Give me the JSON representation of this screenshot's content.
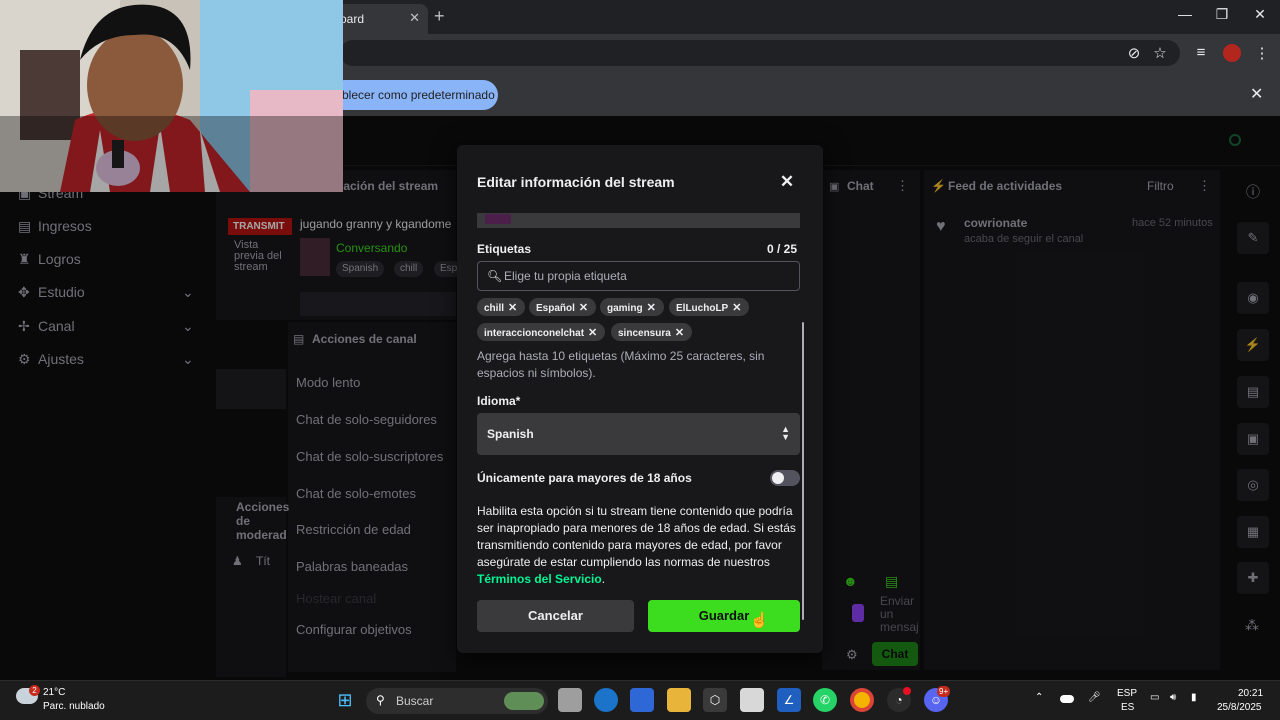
{
  "browser": {
    "tab_title": "oard",
    "infobar_button": "blecer como predeterminado"
  },
  "sidebar": {
    "items": [
      {
        "label": "Stream"
      },
      {
        "label": "Ingresos"
      },
      {
        "label": "Logros"
      },
      {
        "label": "Estudio"
      },
      {
        "label": "Canal"
      },
      {
        "label": "Ajustes"
      }
    ]
  },
  "stream_panel": {
    "header": "nación del stream",
    "live_badge": "TRANSMIT",
    "preview_label": "Vista previa del stream",
    "title": "jugando granny y kgandome",
    "category": "Conversando",
    "tags": [
      "Spanish",
      "chill",
      "Esp"
    ]
  },
  "actions_panel": {
    "header": "Acciones de canal",
    "items": [
      "Modo lento",
      "Chat de solo-seguidores",
      "Chat de solo-suscriptores",
      "Chat de solo-emotes",
      "Restricción de edad",
      "Palabras baneadas",
      "Hostear canal",
      "Configurar objetivos"
    ],
    "mod_header": "Acciones de moderad",
    "mod_title": "Tít"
  },
  "chat_panel": {
    "header": "Chat",
    "input_placeholder": "Enviar un mensaj",
    "send_button": "Chat"
  },
  "feed_panel": {
    "header": "Feed de actividades",
    "filter": "Filtro",
    "event_user": "cowrionate",
    "event_text": "acaba de seguir el canal",
    "event_time": "hace 52 minutos"
  },
  "modal": {
    "title": "Editar información del stream",
    "tags_label": "Etiquetas",
    "tags_count": "0 / 25",
    "tag_input_placeholder": "Elige tu propia etiqueta",
    "tags": [
      "chill",
      "Español",
      "gaming",
      "ElLuchoLP",
      "interaccionconelchat",
      "sincensura"
    ],
    "tags_hint": "Agrega hasta 10 etiquetas (Máximo 25 caracteres, sin espacios ni símbolos).",
    "language_label": "Idioma*",
    "language_value": "Spanish",
    "mature_label": "Únicamente para mayores de 18 años",
    "mature_enabled": false,
    "mature_description": "Habilita esta opción si tu stream tiene contenido que podría ser inapropiado para menores de 18 años de edad. Si estás transmitiendo contenido para mayores de edad, por favor asegúrate de estar cumpliendo las normas de nuestros ",
    "tos_link": "Términos del Servicio",
    "tos_suffix": ".",
    "cancel_button": "Cancelar",
    "save_button": "Guardar"
  },
  "taskbar": {
    "weather_temp": "21°C",
    "weather_desc": "Parc. nublado",
    "weather_badge": "2",
    "search_placeholder": "Buscar",
    "lang_line1": "ESP",
    "lang_line2": "ES",
    "time": "20:21",
    "date": "25/8/2025",
    "discord_badge": "9+"
  },
  "colors": {
    "accent_green": "#3cdd1f",
    "link_green": "#00f593",
    "panel_bg": "#18181b",
    "page_bg": "#0e0e10"
  }
}
